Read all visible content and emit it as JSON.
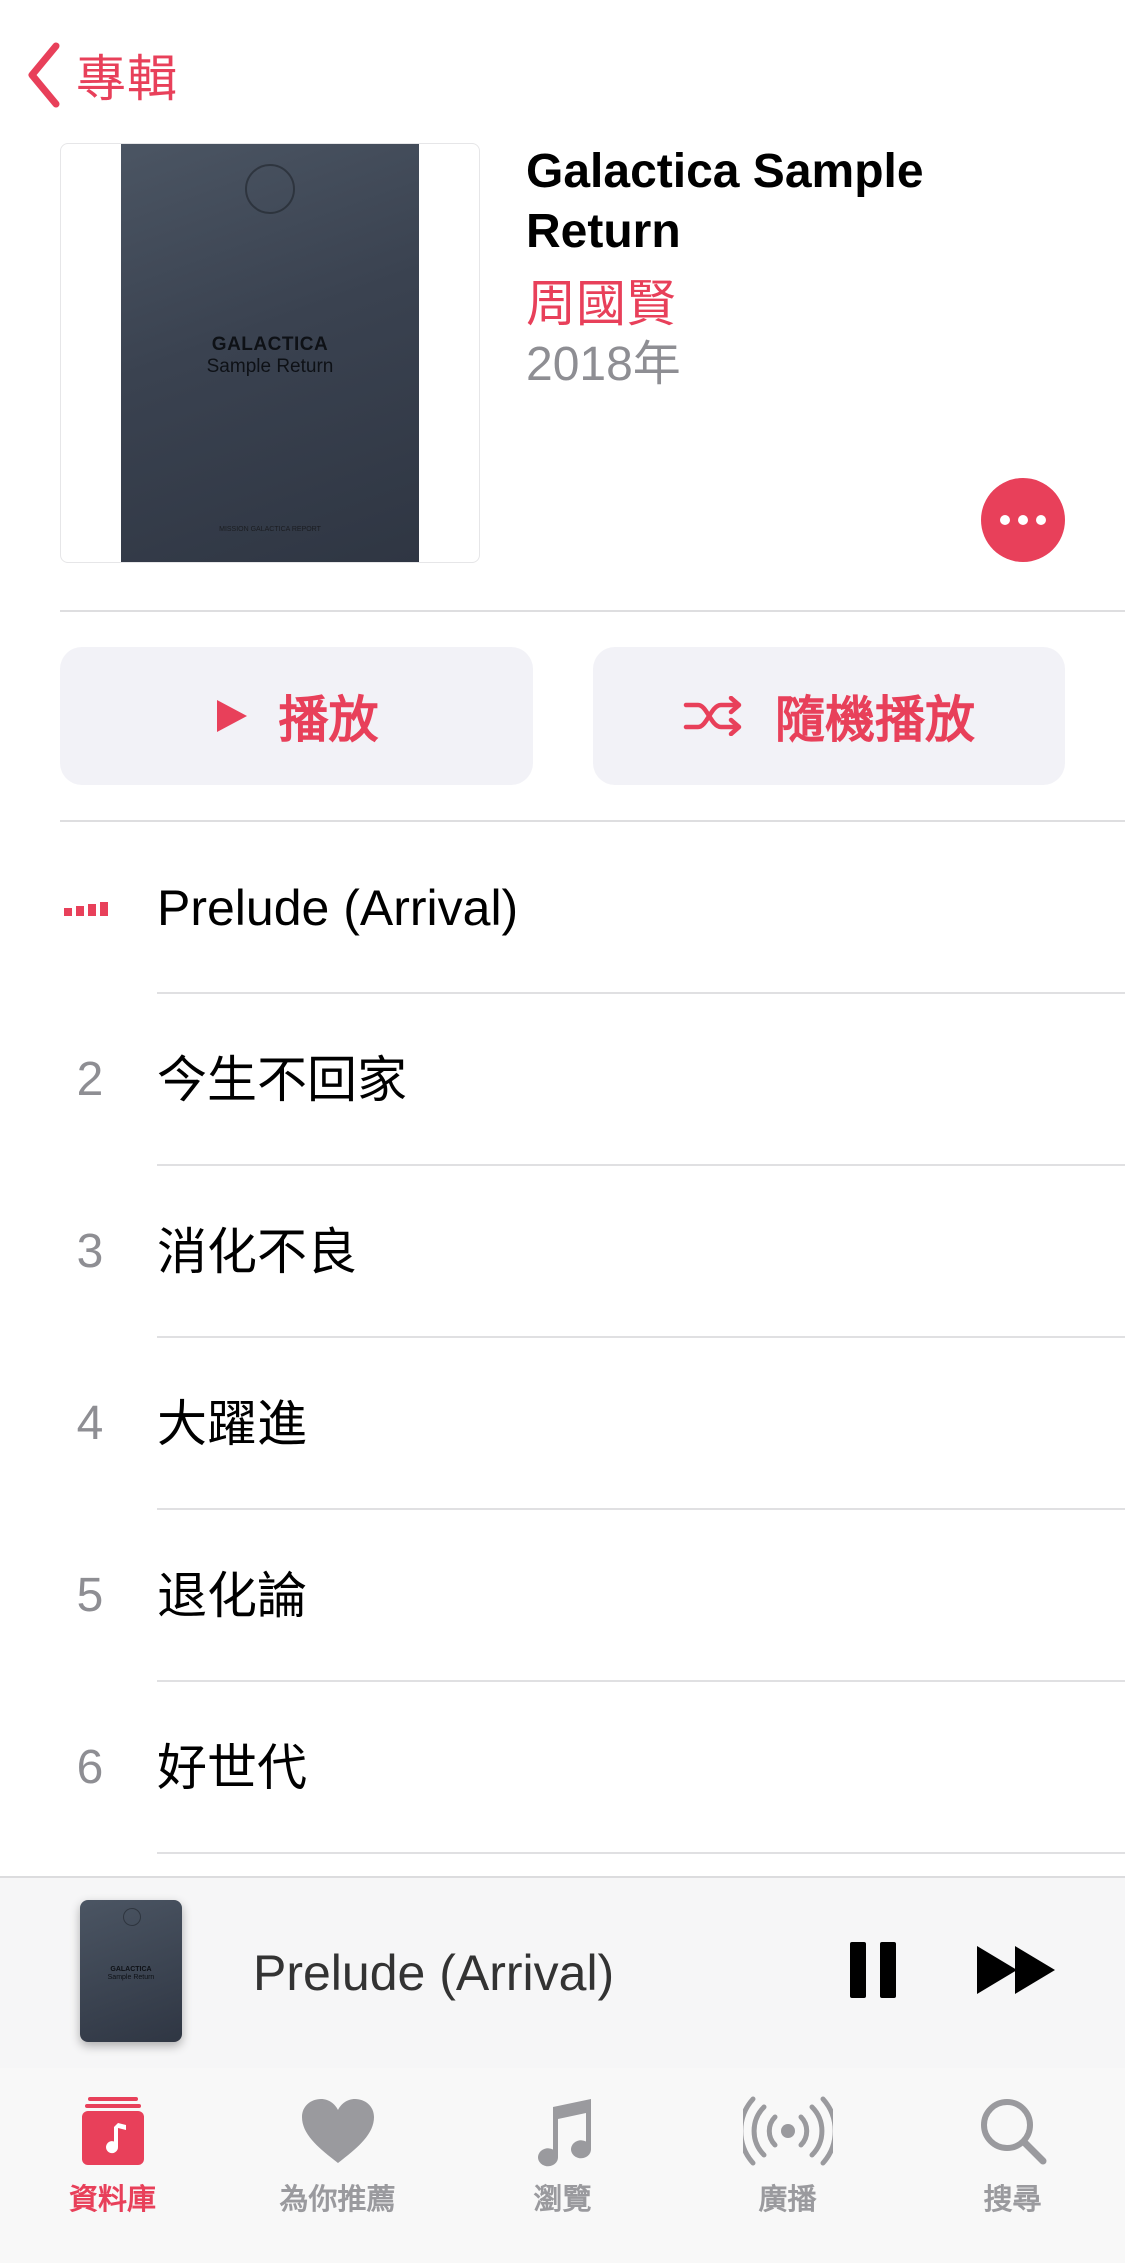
{
  "nav": {
    "back_label": "專輯"
  },
  "album": {
    "title": "Galactica Sample Return",
    "artist": "周國賢",
    "year": "2018年",
    "artwork": {
      "title_line1": "GALACTICA",
      "title_line2": "Sample Return",
      "footer": "MISSION GALACTICA REPORT"
    }
  },
  "actions": {
    "play_label": "播放",
    "shuffle_label": "隨機播放"
  },
  "tracks": [
    {
      "number": "",
      "title": "Prelude (Arrival)",
      "now_playing": true
    },
    {
      "number": "2",
      "title": "今生不回家"
    },
    {
      "number": "3",
      "title": "消化不良"
    },
    {
      "number": "4",
      "title": "大躍進"
    },
    {
      "number": "5",
      "title": "退化論"
    },
    {
      "number": "6",
      "title": "好世代"
    }
  ],
  "mini_player": {
    "title": "Prelude (Arrival)",
    "artwork": {
      "title_line1": "GALACTICA",
      "title_line2": "Sample Return"
    }
  },
  "tabs": [
    {
      "label": "資料庫",
      "icon": "library-icon",
      "active": true
    },
    {
      "label": "為你推薦",
      "icon": "heart-icon"
    },
    {
      "label": "瀏覽",
      "icon": "music-note-icon"
    },
    {
      "label": "廣播",
      "icon": "radio-icon"
    },
    {
      "label": "搜尋",
      "icon": "search-icon"
    }
  ],
  "colors": {
    "accent": "#e8405a",
    "secondary_text": "#8e8e93",
    "button_bg": "#f2f2f7"
  }
}
